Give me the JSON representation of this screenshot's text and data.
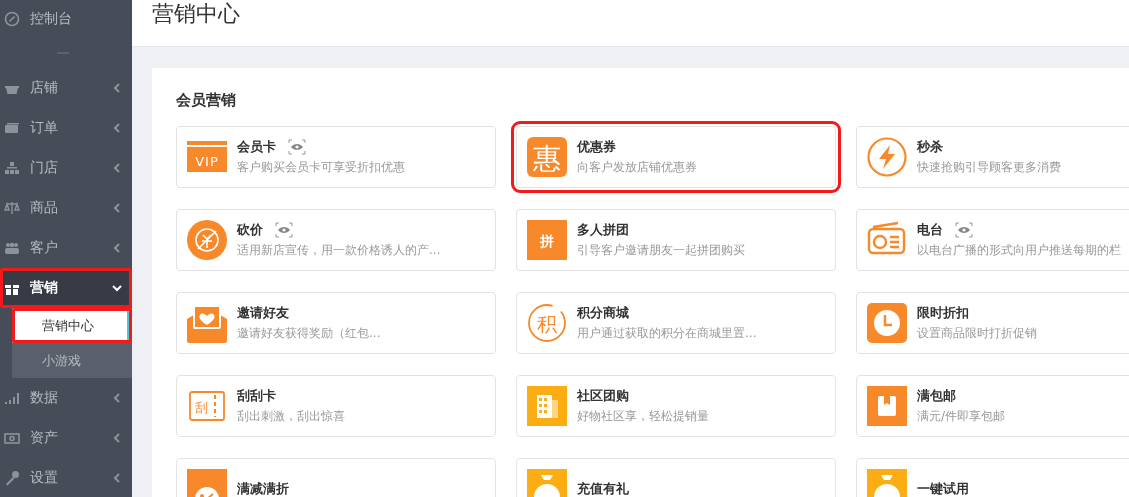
{
  "sidebar": {
    "items": [
      {
        "label": "控制台",
        "kind": "link",
        "selected": false,
        "highlighted": false
      },
      {
        "label": "店铺",
        "kind": "menu",
        "expanded": false,
        "selected": false,
        "highlighted": false
      },
      {
        "label": "订单",
        "kind": "menu",
        "expanded": false,
        "selected": false,
        "highlighted": false
      },
      {
        "label": "门店",
        "kind": "menu",
        "expanded": false,
        "selected": false,
        "highlighted": false
      },
      {
        "label": "商品",
        "kind": "menu",
        "expanded": false,
        "selected": false,
        "highlighted": false
      },
      {
        "label": "客户",
        "kind": "menu",
        "expanded": false,
        "selected": false,
        "highlighted": false
      },
      {
        "label": "营销",
        "kind": "menu",
        "expanded": true,
        "selected": true,
        "highlighted": true,
        "children": [
          {
            "label": "营销中心",
            "selected": true,
            "highlighted": true
          },
          {
            "label": "小游戏",
            "selected": false,
            "highlighted": false
          }
        ]
      },
      {
        "label": "数据",
        "kind": "menu",
        "expanded": false,
        "selected": false,
        "highlighted": false
      },
      {
        "label": "资产",
        "kind": "menu",
        "expanded": false,
        "selected": false,
        "highlighted": false
      },
      {
        "label": "设置",
        "kind": "menu",
        "expanded": false,
        "selected": false,
        "highlighted": false
      }
    ]
  },
  "page": {
    "title": "营销中心"
  },
  "section": {
    "title": "会员营销",
    "cards": [
      {
        "title": "会员卡",
        "description": "客户购买会员卡可享受折扣优惠",
        "preview": true,
        "highlighted": false,
        "icon_text": "VIP"
      },
      {
        "title": "优惠券",
        "description": "向客户发放店铺优惠券",
        "preview": false,
        "highlighted": true,
        "icon_text": "惠"
      },
      {
        "title": "秒杀",
        "description": "快速抢购引导顾客更多消费",
        "preview": false,
        "highlighted": false
      },
      {
        "title": "砍价",
        "description": "适用新店宣传，用一款价格诱人的产...",
        "preview": true,
        "highlighted": false
      },
      {
        "title": "多人拼团",
        "description": "引导客户邀请朋友一起拼团购买",
        "preview": false,
        "highlighted": false,
        "icon_text": "拼"
      },
      {
        "title": "电台",
        "description": "以电台广播的形式向用户推送每期的栏",
        "preview": true,
        "highlighted": false
      },
      {
        "title": "邀请好友",
        "description": "邀请好友获得奖励（红包...",
        "preview": false,
        "highlighted": false
      },
      {
        "title": "积分商城",
        "description": "用户通过获取的积分在商城里置...",
        "preview": false,
        "highlighted": false,
        "icon_text": "积"
      },
      {
        "title": "限时折扣",
        "description": "设置商品限时打折促销",
        "preview": false,
        "highlighted": false
      },
      {
        "title": "刮刮卡",
        "description": "刮出刺激，刮出惊喜",
        "preview": false,
        "highlighted": false,
        "icon_text": "刮"
      },
      {
        "title": "社区团购",
        "description": "好物社区享，轻松提销量",
        "preview": false,
        "highlighted": false
      },
      {
        "title": "满包邮",
        "description": "满元/件即享包邮",
        "preview": false,
        "highlighted": false
      },
      {
        "title": "满减满折",
        "preview": false,
        "highlighted": false
      },
      {
        "title": "充值有礼",
        "preview": false,
        "highlighted": false
      },
      {
        "title": "一键试用",
        "preview": false,
        "highlighted": false
      }
    ]
  }
}
